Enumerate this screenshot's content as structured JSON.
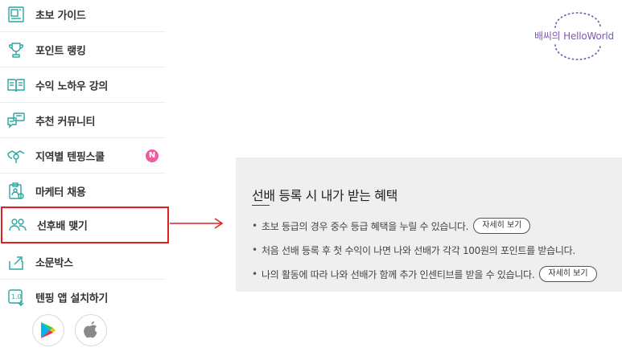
{
  "sidebar": {
    "items": [
      {
        "label": "초보 가이드",
        "icon": "guide-book-icon"
      },
      {
        "label": "포인트 랭킹",
        "icon": "trophy-icon"
      },
      {
        "label": "수익 노하우 강의",
        "icon": "open-book-icon"
      },
      {
        "label": "추천 커뮤니티",
        "icon": "chat-bubble-icon"
      },
      {
        "label": "지역별 텐핑스쿨",
        "icon": "location-map-icon",
        "badge": "N"
      },
      {
        "label": "마케터 채용",
        "icon": "job-clipboard-icon"
      },
      {
        "label": "선후배 맺기",
        "icon": "people-icon"
      },
      {
        "label": "소문박스",
        "icon": "share-box-icon"
      },
      {
        "label": "텐핑 앱 설치하기",
        "icon": "app-install-icon"
      }
    ],
    "store_icons": [
      "google-play-icon",
      "apple-icon"
    ]
  },
  "logo": {
    "text": "배씨의 HelloWorld"
  },
  "panel": {
    "title": "선배 등록 시 내가 받는 혜택",
    "items": [
      {
        "text": "초보 등급의 경우 중수 등급 혜택을 누릴 수 있습니다.",
        "button": "자세히 보기"
      },
      {
        "text": "처음 선배 등록 후 첫 수익이 나면 나와 선배가 각각 100원의 포인트를 받습니다."
      },
      {
        "text": "나의 활동에 따라 나와 선배가 함께 추가 인센티브를 받을 수 있습니다.",
        "button": "자세히 보기"
      }
    ]
  },
  "colors": {
    "accent_icon": "#2aa5a0",
    "highlight_border": "#e0201f",
    "badge": "#f05aa0",
    "logo": "#7b5ab3",
    "panel_bg": "#efefef"
  }
}
